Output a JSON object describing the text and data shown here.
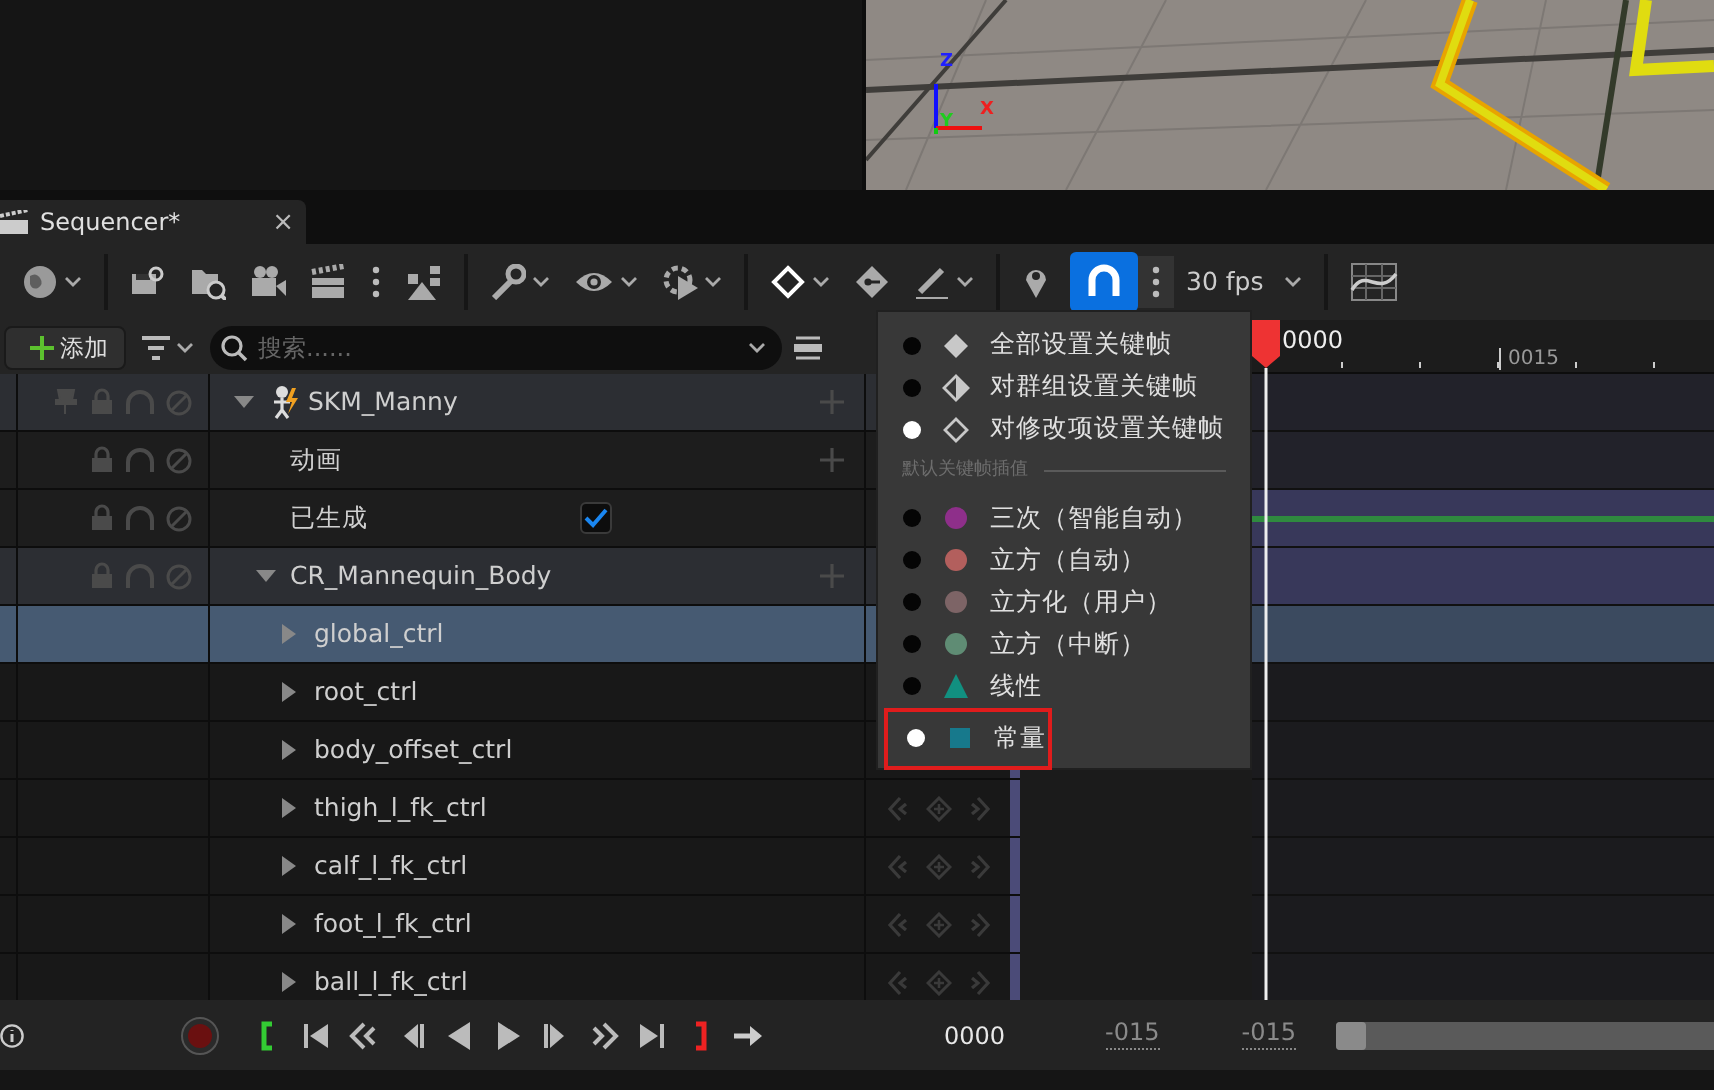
{
  "viewport": {
    "axes": [
      "Z",
      "X",
      "Y"
    ]
  },
  "tab": {
    "title": "Sequencer*",
    "close": "×"
  },
  "toolbar": {
    "items": [
      {
        "kind": "globe",
        "dropdown": true
      },
      {
        "kind": "separator"
      },
      {
        "kind": "save",
        "dropdown": false
      },
      {
        "kind": "folder-search",
        "dropdown": false
      },
      {
        "kind": "camera",
        "dropdown": false
      },
      {
        "kind": "clapboard",
        "dropdown": false
      },
      {
        "kind": "dots",
        "dropdown": false
      },
      {
        "kind": "hierarchy",
        "dropdown": false
      },
      {
        "kind": "separator"
      },
      {
        "kind": "wrench",
        "dropdown": true
      },
      {
        "kind": "eye",
        "dropdown": true
      },
      {
        "kind": "gear-play",
        "dropdown": true
      },
      {
        "kind": "separator"
      },
      {
        "kind": "diamond",
        "dropdown": true
      },
      {
        "kind": "key-diamond",
        "dropdown": false
      },
      {
        "kind": "pen",
        "dropdown": true
      },
      {
        "kind": "separator"
      },
      {
        "kind": "pin",
        "dropdown": false
      },
      {
        "kind": "magnet",
        "dropdown": false,
        "on": true
      },
      {
        "kind": "dots",
        "dropdown": false
      },
      {
        "kind": "fps",
        "label": "30 fps",
        "dropdown": true
      },
      {
        "kind": "separator"
      },
      {
        "kind": "curve-grid",
        "dropdown": false
      }
    ]
  },
  "outliner": {
    "add_label": "添加",
    "search_placeholder": "搜索......",
    "rows": [
      {
        "kind": "actor",
        "label": "SKM_Manny",
        "expanded": true,
        "selected": false,
        "children": [
          {
            "kind": "track",
            "label": "动画",
            "selected": false
          },
          {
            "kind": "property",
            "label": "已生成",
            "checked": true,
            "selected": false
          },
          {
            "kind": "rig",
            "label": "CR_Mannequin_Body",
            "expanded": true,
            "selected": false,
            "children": [
              {
                "kind": "control",
                "label": "global_ctrl",
                "expanded": false,
                "selected": true,
                "key_buttons": false
              },
              {
                "kind": "control",
                "label": "root_ctrl",
                "expanded": false,
                "selected": false,
                "key_buttons": false
              },
              {
                "kind": "control",
                "label": "body_offset_ctrl",
                "expanded": false,
                "selected": false,
                "key_buttons": false
              },
              {
                "kind": "control",
                "label": "thigh_l_fk_ctrl",
                "expanded": false,
                "selected": false,
                "key_buttons": true
              },
              {
                "kind": "control",
                "label": "calf_l_fk_ctrl",
                "expanded": false,
                "selected": false,
                "key_buttons": true
              },
              {
                "kind": "control",
                "label": "foot_l_fk_ctrl",
                "expanded": false,
                "selected": false,
                "key_buttons": true
              },
              {
                "kind": "control",
                "label": "ball_l_fk_ctrl",
                "expanded": false,
                "selected": false,
                "key_buttons": true
              }
            ]
          }
        ]
      }
    ]
  },
  "timeline": {
    "playhead_label": "0000",
    "tick_label": "0015"
  },
  "key_menu": {
    "modes": [
      {
        "label": "全部设置关键帧",
        "selected": false
      },
      {
        "label": "对群组设置关键帧",
        "selected": false
      },
      {
        "label": "对修改项设置关键帧",
        "selected": true
      }
    ],
    "section": "默认关键帧插值",
    "interpolations": [
      {
        "label": "三次（智能自动）",
        "kind": "cubic",
        "color": "#8e2f8a",
        "selected": false,
        "highlighted": false
      },
      {
        "label": "立方（自动）",
        "kind": "cubic",
        "color": "#b35f5d",
        "selected": false,
        "highlighted": false
      },
      {
        "label": "立方化（用户）",
        "kind": "cubic",
        "color": "#7d6466",
        "selected": false,
        "highlighted": false
      },
      {
        "label": "立方（中断）",
        "kind": "cubic",
        "color": "#5f8c74",
        "selected": false,
        "highlighted": false
      },
      {
        "label": "线性",
        "kind": "linear",
        "color": "#119080",
        "selected": false,
        "highlighted": false
      },
      {
        "label": "常量",
        "kind": "constant",
        "color": "#17798c",
        "selected": true,
        "highlighted": true
      }
    ]
  },
  "transport": {
    "time": "0000",
    "start": "-015",
    "end": "-015"
  }
}
